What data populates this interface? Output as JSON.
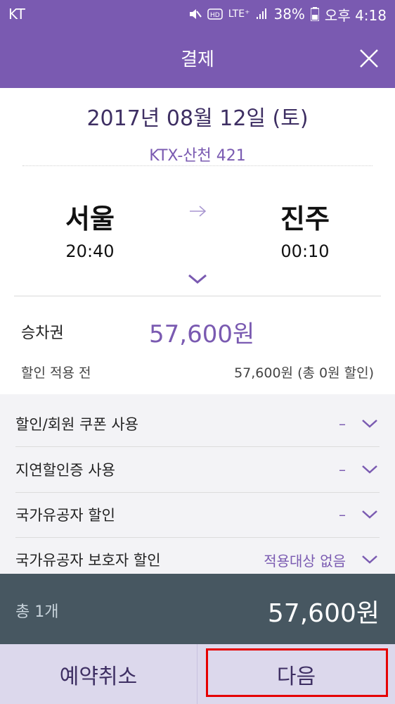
{
  "status": {
    "carrier": "KT",
    "icons": [
      "mute-icon",
      "hd-icon",
      "lte-icon",
      "signal-icon",
      "battery-icon"
    ],
    "lte_label": "LTE⁺",
    "battery": "38%",
    "time": "오후 4:18"
  },
  "header": {
    "title": "결제",
    "close_icon": "close-icon"
  },
  "trip": {
    "date": "2017년 08월 12일 (토)",
    "train": "KTX-산천 421",
    "from": {
      "station": "서울",
      "time": "20:40"
    },
    "to": {
      "station": "진주",
      "time": "00:10"
    }
  },
  "fare": {
    "ticket_label": "승차권",
    "ticket_value": "57,600원",
    "pre_label": "할인 적용 전",
    "pre_value": "57,600원 (총 0원 할인)"
  },
  "discounts": [
    {
      "label": "할인/회원 쿠폰 사용",
      "value": "–"
    },
    {
      "label": "지연할인증 사용",
      "value": "–"
    },
    {
      "label": "국가유공자 할인",
      "value": "–"
    },
    {
      "label": "국가유공자 보호자 할인",
      "value": "적용대상 없음"
    }
  ],
  "total": {
    "label": "총 1개",
    "value": "57,600원"
  },
  "buttons": {
    "cancel": "예약취소",
    "next": "다음"
  },
  "colors": {
    "accent": "#7a5ab1",
    "total_bar": "#475761",
    "button_bg": "#dcd8ec",
    "highlight": "#e60000"
  }
}
